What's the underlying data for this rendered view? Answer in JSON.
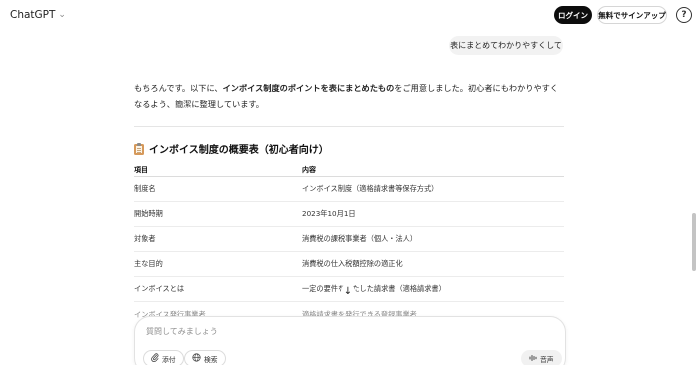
{
  "header": {
    "brand": "ChatGPT",
    "login_label": "ログイン",
    "signup_label": "無料でサインアップ",
    "help_label": "?"
  },
  "chat": {
    "user_message": "表にまとめてわかりやすくして",
    "assistant_intro_before": "もちろんです。以下に、",
    "assistant_intro_bold": "インボイス制度のポイントを表にまとめたもの",
    "assistant_intro_after": "をご用意しました。初心者にもわかりやすくなるよう、簡潔に整理しています。",
    "section_title": "インボイス制度の概要表（初心者向け）",
    "table": {
      "headers": [
        "項目",
        "内容"
      ],
      "rows": [
        [
          "制度名",
          "インボイス制度（適格請求書等保存方式）"
        ],
        [
          "開始時期",
          "2023年10月1日"
        ],
        [
          "対象者",
          "消費税の課税事業者（個人・法人）"
        ],
        [
          "主な目的",
          "消費税の仕入税額控除の適正化"
        ],
        [
          "インボイスとは",
          "一定の要件を満たした請求書（適格請求書）"
        ],
        [
          "インボイス発行事業者",
          "適格請求書を発行できる登録事業者"
        ]
      ]
    }
  },
  "composer": {
    "placeholder": "質問してみましょう",
    "attach_label": "添付",
    "search_label": "検索",
    "voice_label": "音声"
  }
}
